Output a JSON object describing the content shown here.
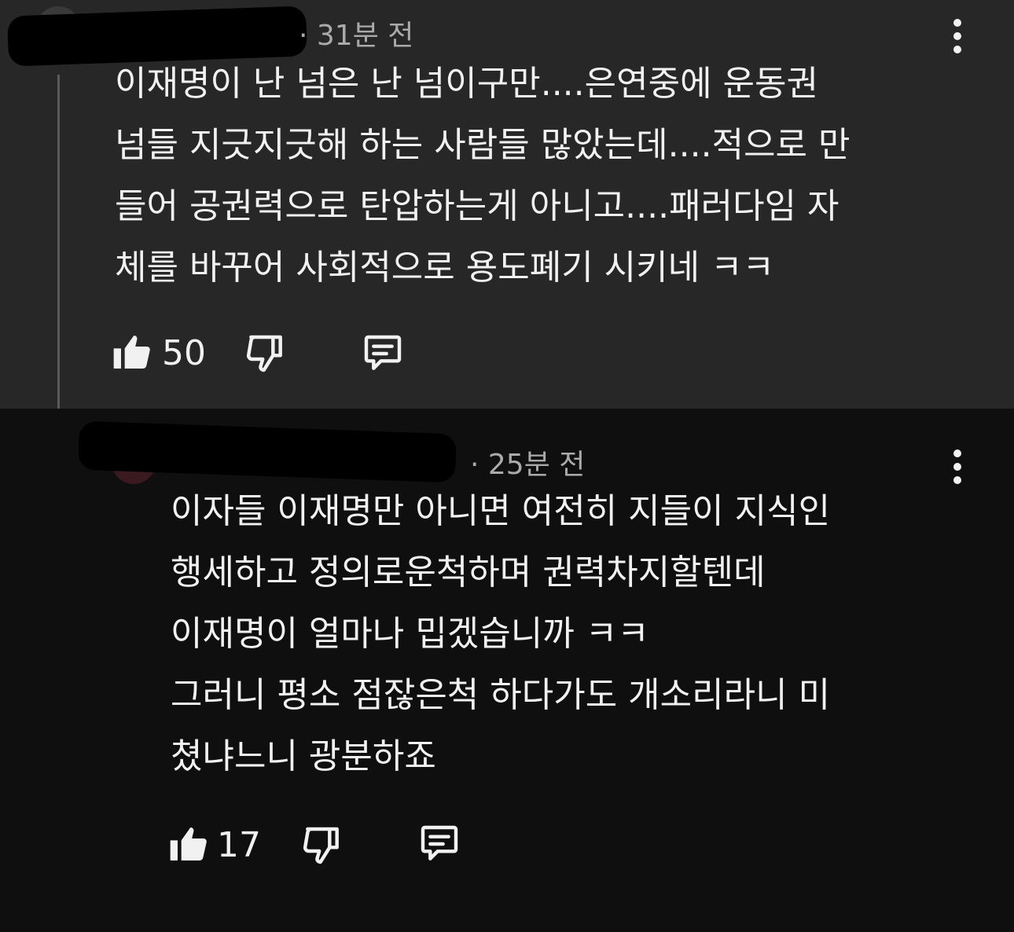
{
  "comments": [
    {
      "timestamp": "· 31분 전",
      "lines": [
        "이재명이 난 넘은 난 넘이구만....은연중에 운동권",
        "넘들 지긋지긋해 하는 사람들 많았는데....적으로 만",
        "들어 공권력으로 탄압하는게 아니고....패러다임 자",
        "체를 바꾸어 사회적으로 용도폐기 시키네 ㅋㅋ"
      ],
      "like_count": "50"
    },
    {
      "timestamp": "· 25분 전",
      "lines": [
        "이자들 이재명만 아니면 여전히 지들이 지식인",
        "행세하고 정의로운척하며 권력차지할텐데",
        "이재명이 얼마나 밉겠습니까 ㅋㅋ",
        "그러니 평소 점잖은척 하다가도 개소리라니 미",
        "쳤냐느니 광분하죠"
      ],
      "like_count": "17"
    }
  ],
  "icons": {
    "like": "thumbs-up-icon",
    "dislike": "thumbs-down-icon",
    "reply": "comment-icon",
    "more": "more-vert-icon"
  },
  "colors": {
    "parent_bg": "#272727",
    "reply_bg": "#0f0f0f",
    "text": "#f1f1f1",
    "meta": "#aaaaaa"
  }
}
